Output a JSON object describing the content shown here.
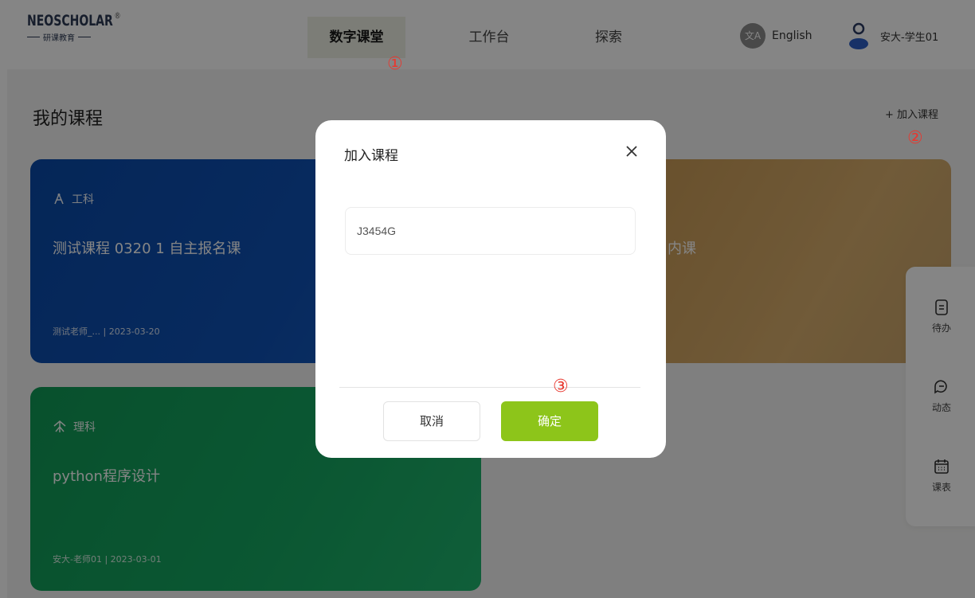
{
  "header": {
    "logo_text": "NEOSCHOLAR",
    "logo_mark": "®",
    "logo_subtitle": "研课教育",
    "nav": [
      {
        "label": "数字课堂",
        "active": true
      },
      {
        "label": "工作台",
        "active": false
      },
      {
        "label": "探索",
        "active": false
      }
    ],
    "language_icon": "文A",
    "language": "English",
    "username": "安大-学生01"
  },
  "annotations": [
    "①",
    "②",
    "③"
  ],
  "page": {
    "section_title": "我的课程",
    "join_course_link": "+ 加入课程"
  },
  "courses": [
    {
      "category": "工科",
      "title": "测试课程 0320 1 自主报名课",
      "teacher": "测试老师_...",
      "date": "| 2023-03-20",
      "color": "#0f52b6"
    },
    {
      "category": "",
      "title": "内课",
      "teacher": "",
      "date": "",
      "color": "#d4a866"
    },
    {
      "category": "理科",
      "title": "python程序设计",
      "teacher": "安大-老师01",
      "date": "| 2023-03-01",
      "color": "#16a862"
    }
  ],
  "side_panel": [
    {
      "label": "待办",
      "icon": "document-icon"
    },
    {
      "label": "动态",
      "icon": "chat-icon"
    },
    {
      "label": "课表",
      "icon": "calendar-icon"
    }
  ],
  "modal": {
    "title": "加入课程",
    "input_value": "J3454G",
    "cancel_label": "取消",
    "confirm_label": "确定",
    "confirm_color": "#8dc51a"
  }
}
